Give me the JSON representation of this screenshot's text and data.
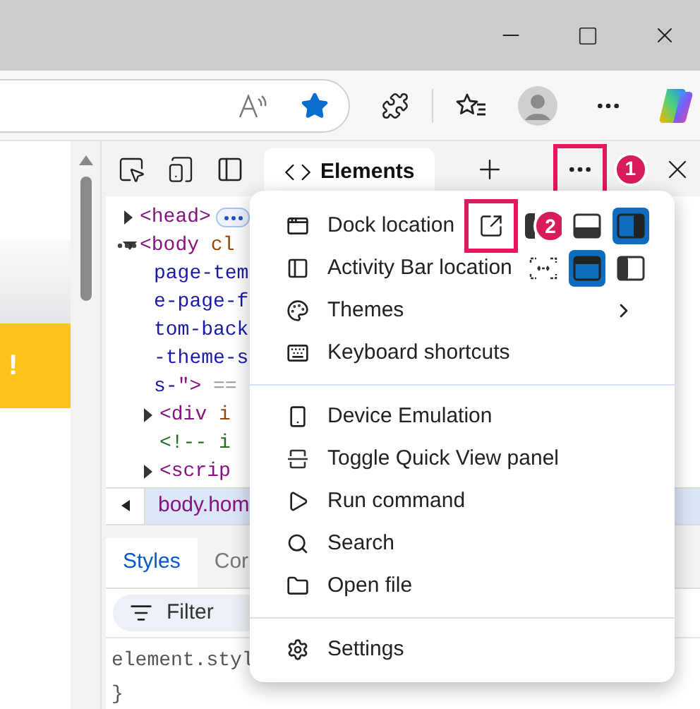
{
  "toolbar": {
    "favorited": true
  },
  "page": {
    "banner": {
      "text": "!"
    }
  },
  "devtools": {
    "tabs": [
      {
        "label": "Elements",
        "selected": true
      }
    ],
    "more_tools": {
      "highlighted": true,
      "badge": "1"
    },
    "tree": [
      {
        "expanded": false,
        "collapsed_badge": true,
        "lines": [
          [
            {
              "text": "<head>",
              "kind": "tag"
            }
          ]
        ]
      },
      {
        "expanded": true,
        "lines": [
          [
            {
              "text": "<body",
              "kind": "tag"
            },
            {
              "text": " cl",
              "kind": "attr"
            }
          ],
          [
            {
              "text": "page-tem",
              "kind": "value"
            }
          ],
          [
            {
              "text": "e-page-f",
              "kind": "value"
            }
          ],
          [
            {
              "text": "tom-back",
              "kind": "value"
            }
          ],
          [
            {
              "text": "-theme-s",
              "kind": "value"
            }
          ],
          [
            {
              "text": "s-",
              "kind": "value"
            },
            {
              "text": "\">",
              "kind": "tag"
            },
            {
              "text": " ==",
              "kind": "punct"
            }
          ]
        ],
        "children": [
          {
            "expanded": false,
            "lines": [
              [
                {
                  "text": "<div",
                  "kind": "tag"
                },
                {
                  "text": " i",
                  "kind": "attr"
                }
              ]
            ]
          },
          {
            "lines": [
              [
                {
                  "text": "<!-- i",
                  "kind": "comment"
                }
              ]
            ]
          },
          {
            "expanded": false,
            "lines": [
              [
                {
                  "text": "<scrip",
                  "kind": "tag"
                }
              ]
            ]
          }
        ]
      }
    ],
    "breadcrumb": [
      "body.hom"
    ],
    "styles_tabs": [
      {
        "label": "Styles",
        "selected": true
      },
      {
        "label": "Cor",
        "selected": false
      }
    ],
    "filter": {
      "placeholder": "Filter"
    },
    "styles_lines": [
      "element.styl",
      "}"
    ]
  },
  "menu": {
    "sections": [
      [
        {
          "label": "Dock location",
          "options": [
            {
              "kind": "undock",
              "selected": false,
              "highlighted": true
            },
            {
              "kind": "left",
              "selected": false,
              "badge": "2"
            },
            {
              "kind": "bottom",
              "selected": false
            },
            {
              "kind": "right",
              "selected": true
            }
          ]
        },
        {
          "label": "Activity Bar location",
          "options": [
            {
              "kind": "hidden",
              "selected": false
            },
            {
              "kind": "top",
              "selected": true
            },
            {
              "kind": "left",
              "selected": false
            }
          ]
        },
        {
          "label": "Themes",
          "submenu": true
        },
        {
          "label": "Keyboard shortcuts"
        }
      ],
      [
        {
          "label": "Device Emulation"
        },
        {
          "label": "Toggle Quick View panel"
        },
        {
          "label": "Run command"
        },
        {
          "label": "Search"
        },
        {
          "label": "Open file"
        }
      ],
      [
        {
          "label": "Settings"
        }
      ]
    ]
  }
}
